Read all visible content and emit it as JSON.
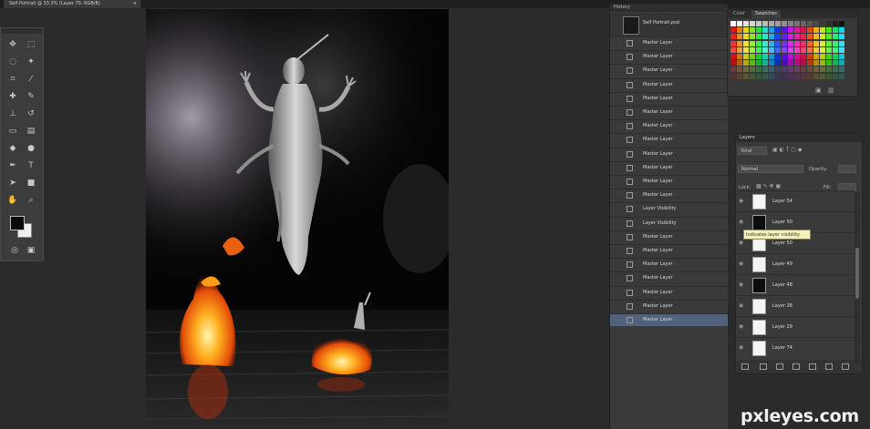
{
  "document_tab": {
    "label": "Self Portrait @ 33.3% (Layer 70, RGB/8)",
    "close_label": "×"
  },
  "tools": [
    {
      "icon": "move-icon",
      "glyph": "✥"
    },
    {
      "icon": "marquee-icon",
      "glyph": "⬚"
    },
    {
      "icon": "lasso-icon",
      "glyph": "◌"
    },
    {
      "icon": "magic-wand-icon",
      "glyph": "✦"
    },
    {
      "icon": "crop-icon",
      "glyph": "⌗"
    },
    {
      "icon": "eyedropper-icon",
      "glyph": "⁄"
    },
    {
      "icon": "healing-icon",
      "glyph": "✚"
    },
    {
      "icon": "brush-icon",
      "glyph": "✎"
    },
    {
      "icon": "stamp-icon",
      "glyph": "⊥"
    },
    {
      "icon": "history-brush-icon",
      "glyph": "↺"
    },
    {
      "icon": "eraser-icon",
      "glyph": "▭"
    },
    {
      "icon": "gradient-icon",
      "glyph": "▤"
    },
    {
      "icon": "blur-icon",
      "glyph": "◆"
    },
    {
      "icon": "dodge-icon",
      "glyph": "●"
    },
    {
      "icon": "pen-icon",
      "glyph": "✒"
    },
    {
      "icon": "type-icon",
      "glyph": "T"
    },
    {
      "icon": "path-select-icon",
      "glyph": "➤"
    },
    {
      "icon": "shape-icon",
      "glyph": "■"
    },
    {
      "icon": "hand-icon",
      "glyph": "✋"
    },
    {
      "icon": "zoom-icon",
      "glyph": "⌕"
    }
  ],
  "colors": {
    "foreground": "#0a0a0a",
    "background": "#efefef",
    "history_selected": "#50627c"
  },
  "history": {
    "title": "History",
    "snapshot_label": "Self Portrait.psd",
    "items": [
      "Master Layer",
      "Master Layer",
      "Master Layer",
      "Master Layer",
      "Master Layer",
      "Master Layer",
      "Master Layer",
      "Master Layer",
      "Master Layer",
      "Master Layer",
      "Master Layer",
      "Master Layer",
      "Layer Visibility",
      "Layer Visibility",
      "Master Layer",
      "Master Layer",
      "Master Layer",
      "Master Layer",
      "Master Layer",
      "Master Layer",
      "Master Layer"
    ],
    "selected_index": 20
  },
  "swatches": {
    "tabs": [
      "Color",
      "Swatches"
    ],
    "active_tab": 1
  },
  "layers": {
    "title": "Layers",
    "kind_label": "Kind",
    "blend_label": "Normal",
    "opacity_label": "Opacity:",
    "lock_label": "Lock:",
    "fill_label": "Fill:",
    "rows": [
      {
        "name": "Layer 54",
        "dark": false
      },
      {
        "name": "Layer 50",
        "dark": true
      },
      {
        "name": "Layer 50",
        "dark": false
      },
      {
        "name": "Layer 49",
        "dark": false
      },
      {
        "name": "Layer 48",
        "dark": true
      },
      {
        "name": "Layer 28",
        "dark": false
      },
      {
        "name": "Layer 29",
        "dark": false
      },
      {
        "name": "Layer 74",
        "dark": false
      }
    ],
    "tooltip": "Indicates layer visibility"
  },
  "watermark": "pxleyes.com"
}
